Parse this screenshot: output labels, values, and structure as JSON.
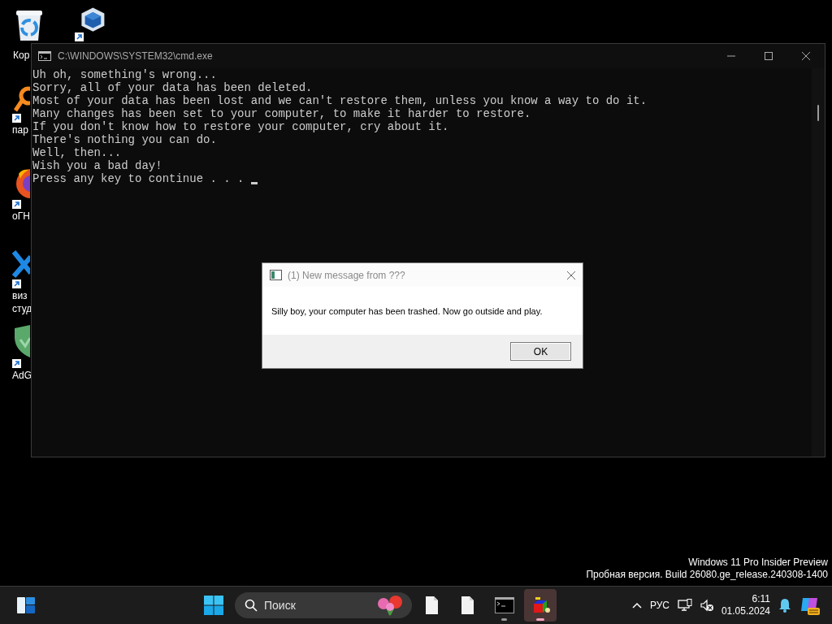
{
  "desktop_icons": [
    {
      "kind": "recycle-bin",
      "label_lines": [
        "Кор"
      ],
      "shortcut": false
    },
    {
      "kind": "cube",
      "shortcut": true
    },
    {
      "kind": "orange-ring",
      "label_lines": [
        "пар"
      ],
      "shortcut": true
    },
    {
      "kind": "browser",
      "label_lines": [
        "оГН"
      ],
      "shortcut": true
    },
    {
      "kind": "blue-x",
      "label_lines": [
        "виз",
        "студ"
      ],
      "shortcut": true
    },
    {
      "kind": "shield",
      "label_lines": [
        "AdG"
      ],
      "shortcut": true
    }
  ],
  "console_window": {
    "title": "C:\\WINDOWS\\SYSTEM32\\cmd.exe",
    "lines": [
      "Uh oh, something's wrong...",
      "Sorry, all of your data has been deleted.",
      "Most of your data has been lost and we can't restore them, unless you know a way to do it.",
      "Many changes has been set to your computer, to make it harder to restore.",
      "If you don't know how to restore your computer, cry about it.",
      "There's nothing you can do.",
      "Well, then...",
      "Wish you a bad day!",
      "Press any key to continue . . . "
    ]
  },
  "message_box": {
    "title": "(1) New message from ???",
    "message": "Silly boy, your computer has been trashed. Now go outside and play.",
    "buttons": [
      "OK"
    ]
  },
  "system_info": [
    "Windows 11 Pro Insider Preview",
    "Пробная версия. Build 26080.ge_release.240308-1400"
  ],
  "taskbar": {
    "search": {
      "placeholder": "Поиск"
    },
    "apps": [
      {
        "kind": "file",
        "running": false,
        "selected": false
      },
      {
        "kind": "file",
        "running": false,
        "selected": false
      },
      {
        "kind": "console",
        "running": true,
        "selected": false
      },
      {
        "kind": "cube",
        "running": true,
        "selected": true
      }
    ],
    "tray": {
      "language": "РУС",
      "time": "6:11",
      "date": "01.05.2024"
    }
  }
}
